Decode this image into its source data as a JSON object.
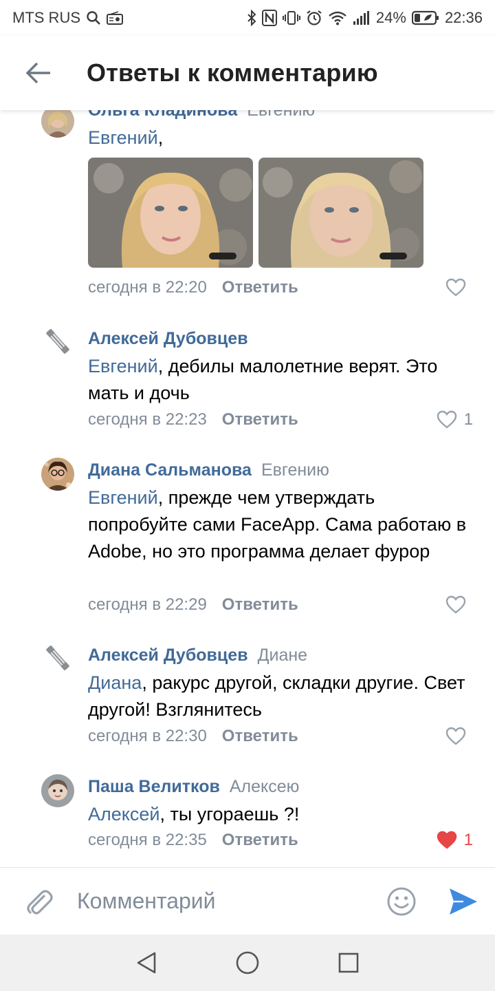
{
  "status_bar": {
    "carrier": "MTS RUS",
    "battery": "24%",
    "time": "22:36"
  },
  "header": {
    "title": "Ответы к комментарию"
  },
  "comments": [
    {
      "author": "Ольга Кладинова",
      "reply_to": "Евгению",
      "mention": "Евгений",
      "text": ",",
      "time": "сегодня в 22:20",
      "reply_label": "Ответить",
      "likes": "",
      "liked": false
    },
    {
      "author": "Алексей Дубовцев",
      "reply_to": "",
      "mention": "Евгений",
      "text": ", дебилы малолетние верят. Это мать и дочь",
      "time": "сегодня в 22:23",
      "reply_label": "Ответить",
      "likes": "1",
      "liked": false
    },
    {
      "author": "Диана Сальманова",
      "reply_to": "Евгению",
      "mention": "Евгений",
      "text": ", прежде чем утверждать попробуйте сами FaceApp. Сама работаю в Adobe, но это программа делает фурор",
      "time": "сегодня в 22:29",
      "reply_label": "Ответить",
      "likes": "",
      "liked": false
    },
    {
      "author": "Алексей Дубовцев",
      "reply_to": "Диане",
      "mention": "Диана",
      "text": ", ракурс другой, складки другие. Свет другой! Взглянитесь",
      "time": "сегодня в 22:30",
      "reply_label": "Ответить",
      "likes": "",
      "liked": false
    },
    {
      "author": "Паша Велитков",
      "reply_to": "Алексею",
      "mention": "Алексей",
      "text": ", ты угораешь ?!",
      "time": "сегодня в 22:35",
      "reply_label": "Ответить",
      "likes": "1",
      "liked": true
    }
  ],
  "composer": {
    "placeholder": "Комментарий"
  },
  "colors": {
    "link": "#416a98",
    "secondary": "#818c99",
    "like_active": "#e64646",
    "send": "#3f8ae0"
  },
  "icons": [
    "back-arrow-icon",
    "attach-icon",
    "emoji-icon",
    "send-icon",
    "heart-icon",
    "nav-back-icon",
    "nav-home-icon",
    "nav-recents-icon"
  ]
}
